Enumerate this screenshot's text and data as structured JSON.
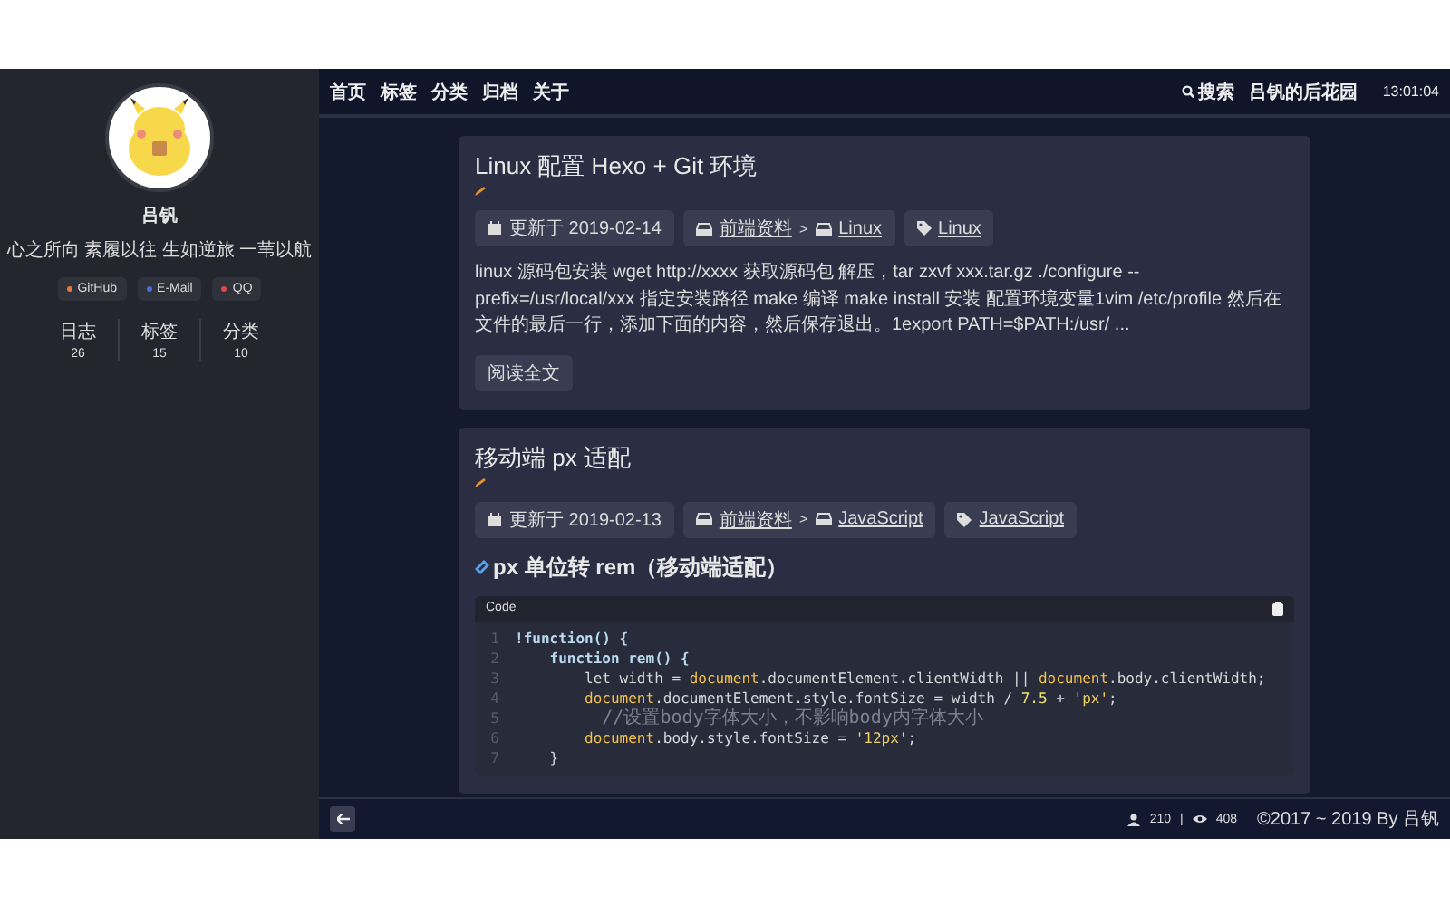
{
  "sidebar": {
    "name": "吕钒",
    "motto": "心之所向 素履以往 生如逆旅 一苇以航",
    "links": [
      {
        "label": "GitHub",
        "color": "#e8763a"
      },
      {
        "label": "E-Mail",
        "color": "#4a6ee0"
      },
      {
        "label": "QQ",
        "color": "#e04848"
      }
    ],
    "stats": [
      {
        "label": "日志",
        "value": "26"
      },
      {
        "label": "标签",
        "value": "15"
      },
      {
        "label": "分类",
        "value": "10"
      }
    ]
  },
  "nav": {
    "items": [
      "首页",
      "标签",
      "分类",
      "归档",
      "关于"
    ],
    "search": "搜索",
    "site_title": "吕钒的后花园",
    "time": "13:01:04"
  },
  "posts": [
    {
      "title": "Linux 配置 Hexo + Git 环境",
      "date": "更新于 2019-02-14",
      "categories": [
        "前端资料",
        "Linux"
      ],
      "separator": ">",
      "tags": [
        "Linux"
      ],
      "excerpt": "linux 源码包安装 wget http://xxxx 获取源码包 解压，tar zxvf xxx.tar.gz ./configure --prefix=/usr/local/xxx 指定安装路径 make 编译 make install 安装 配置环境变量1vim /etc/profile 然后在文件的最后一行，添加下面的内容，然后保存退出。1export PATH=$PATH:/usr/ ...",
      "read_more": "阅读全文"
    },
    {
      "title": "移动端 px 适配",
      "date": "更新于 2019-02-13",
      "categories": [
        "前端资料",
        "JavaScript"
      ],
      "separator": ">",
      "tags": [
        "JavaScript"
      ],
      "heading": "px 单位转 rem（移动端适配）",
      "code": {
        "label": "Code",
        "lines": [
          {
            "number": "1",
            "tokens": [
              {
                "kind": "kw",
                "text": "!function() {"
              }
            ]
          },
          {
            "number": "2",
            "tokens": [
              {
                "kind": "kw",
                "text": "    function rem() {"
              }
            ]
          },
          {
            "number": "3",
            "tokens": [
              {
                "kind": "plain",
                "text": "        let width = "
              },
              {
                "kind": "obj",
                "text": "document"
              },
              {
                "kind": "plain",
                "text": ".documentElement.clientWidth || "
              },
              {
                "kind": "obj",
                "text": "document"
              },
              {
                "kind": "plain",
                "text": ".body.clientWidth;"
              }
            ]
          },
          {
            "number": "4",
            "tokens": [
              {
                "kind": "obj",
                "text": "        document"
              },
              {
                "kind": "plain",
                "text": ".documentElement.style.fontSize = width / "
              },
              {
                "kind": "num",
                "text": "7.5"
              },
              {
                "kind": "plain",
                "text": " + "
              },
              {
                "kind": "str",
                "text": "'px'"
              },
              {
                "kind": "plain",
                "text": ";"
              }
            ]
          },
          {
            "number": "5",
            "tokens": [
              {
                "kind": "comment",
                "text": "        //设置body字体大小，不影响body内字体大小"
              }
            ]
          },
          {
            "number": "6",
            "tokens": [
              {
                "kind": "obj",
                "text": "        document"
              },
              {
                "kind": "plain",
                "text": ".body.style.fontSize = "
              },
              {
                "kind": "str",
                "text": "'12px'"
              },
              {
                "kind": "plain",
                "text": ";"
              }
            ]
          },
          {
            "number": "7",
            "tokens": [
              {
                "kind": "plain",
                "text": "    }"
              }
            ]
          }
        ]
      }
    }
  ],
  "footer": {
    "visitors": "210",
    "separator": "|",
    "views": "408",
    "copyright": "©2017 ~ 2019 By 吕钒"
  }
}
